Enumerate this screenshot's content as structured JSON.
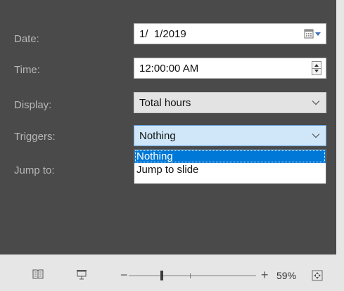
{
  "fields": {
    "date": {
      "label": "Date:",
      "value": "1/  1/2019"
    },
    "time": {
      "label": "Time:",
      "value": "12:00:00 AM"
    },
    "display": {
      "label": "Display:",
      "value": "Total hours"
    },
    "triggers": {
      "label": "Triggers:",
      "value": "Nothing"
    },
    "jump_to": {
      "label": "Jump to:"
    }
  },
  "triggers_dropdown": {
    "options": [
      "Nothing",
      "Jump to slide"
    ],
    "selected": "Nothing"
  },
  "statusbar": {
    "zoom_minus": "−",
    "zoom_plus": "+",
    "zoom_percent": "59%",
    "icons": [
      "reading-view-icon",
      "slide-show-icon",
      "fit-to-window-icon"
    ]
  },
  "colors": {
    "panel_bg": "#4a4a4a",
    "label": "#b7b7b7",
    "focus_bg": "#cfe7f9",
    "selection": "#0078d7"
  }
}
